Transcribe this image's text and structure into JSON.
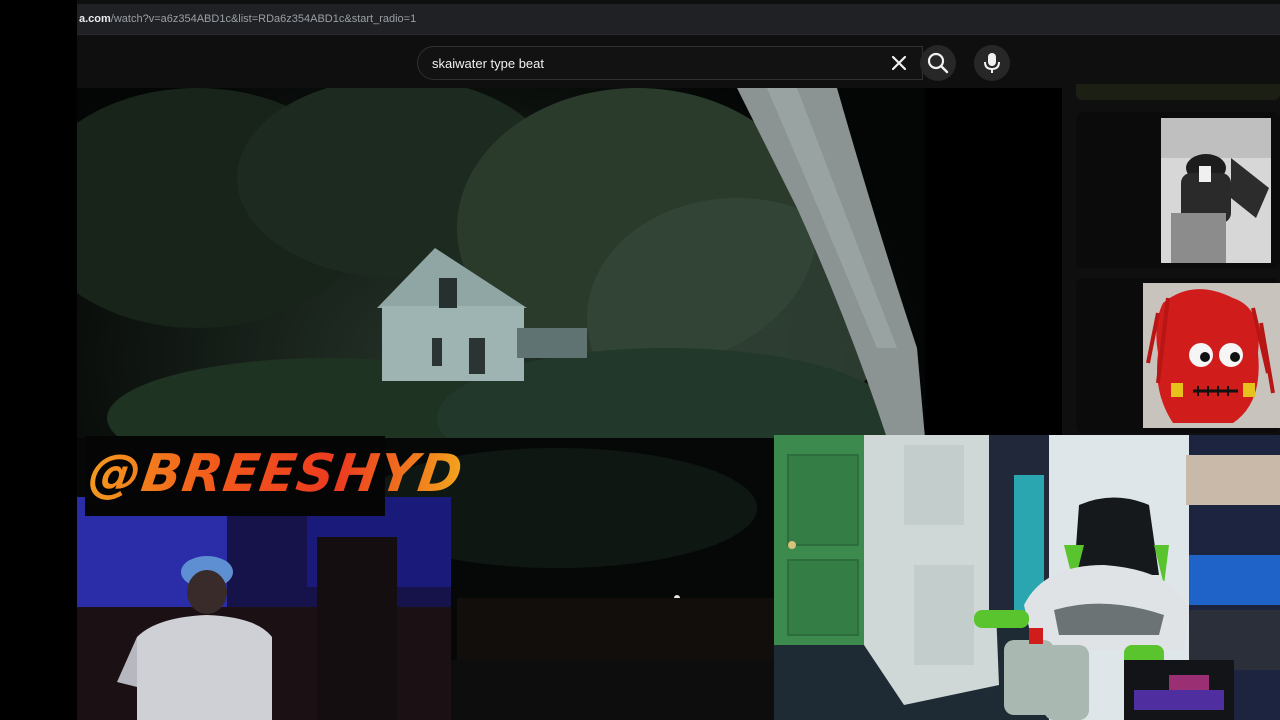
{
  "browser": {
    "url_domain": "a.com",
    "url_path": "/watch?v=a6z354ABD1c&list=RDa6z354ABD1c&start_radio=1"
  },
  "search": {
    "query": "skaiwater type beat",
    "clear_icon": "close-icon",
    "search_icon": "search-icon",
    "mic_icon": "mic-icon"
  },
  "overlay": {
    "watermark": "@BREESHYD"
  },
  "colors": {
    "page_bg": "#0f0f0f",
    "watermark_gradient": [
      "#f39a1e",
      "#ec3a20",
      "#f3a51d"
    ]
  }
}
